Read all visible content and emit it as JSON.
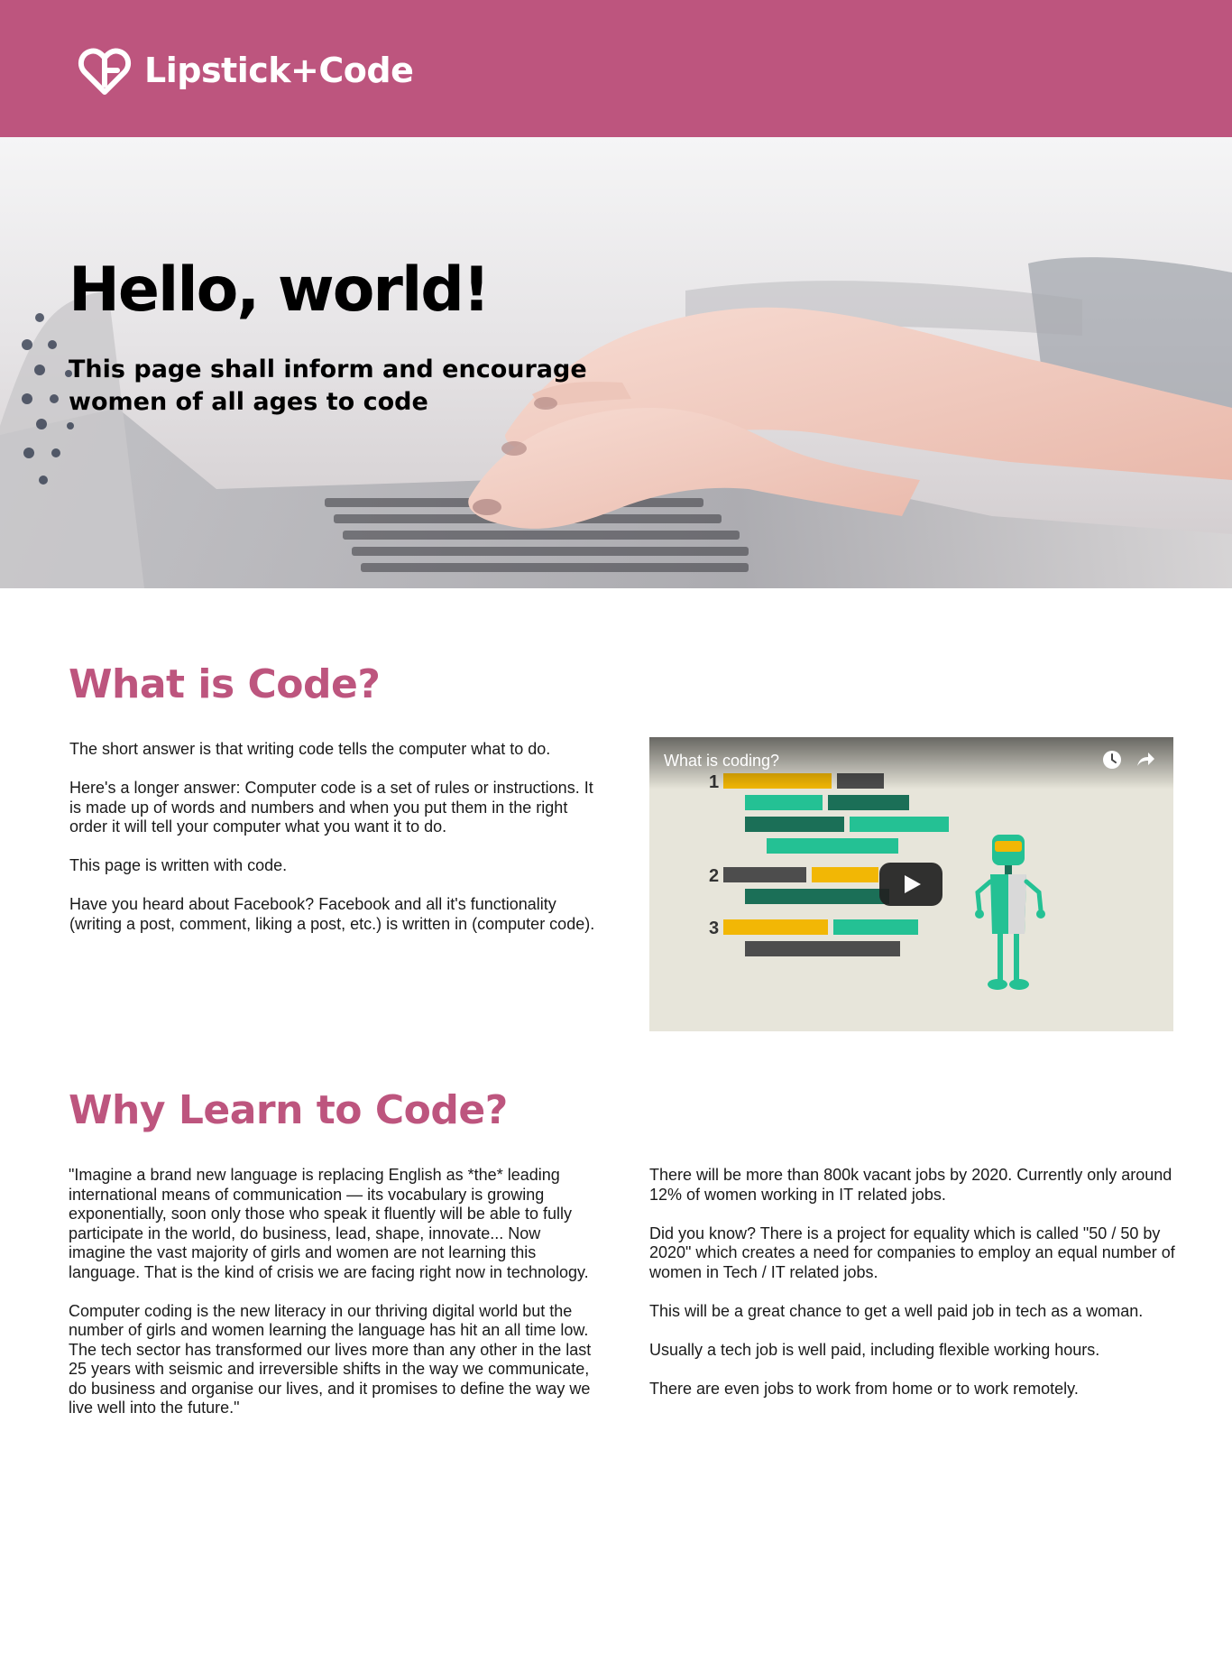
{
  "header": {
    "brand_name": "Lipstick+Code",
    "logo_icon": "heart-b-logo-icon"
  },
  "hero": {
    "title": "Hello, world!",
    "subtitle": "This page shall inform and encourage women of all ages to code"
  },
  "what": {
    "title": "What is Code?",
    "paragraphs": [
      "The short answer is that writing code tells the computer what to do.",
      "Here's a longer answer: Computer code is a set of rules or instructions. It is made up of words and numbers and when you put them in the right order it will tell your computer what you want it to do.",
      "This page is written with code.",
      "Have you heard about Facebook? Facebook and all it's functionality (writing a post, comment, liking a post, etc.) is written in (computer code)."
    ],
    "video": {
      "title": "What is coding?",
      "watch_later_icon": "clock-icon",
      "share_icon": "share-arrow-icon",
      "play_icon": "play-icon",
      "labels": [
        "1",
        "2",
        "3"
      ]
    }
  },
  "why": {
    "title": "Why Learn to Code?",
    "left_paragraphs": [
      "\"Imagine a brand new language is replacing English as *the* leading international means of communication — its vocabulary is growing exponentially, soon only those who speak it fluently will be able to fully participate in the world, do business, lead, shape, innovate... Now imagine the vast majority of girls and women are not learning this language. That is the kind of crisis we are facing right now in technology.",
      "Computer coding is the new literacy in our thriving digital world but the number of girls and women learning the language has hit an all time low. The tech sector has transformed our lives more than any other in the last 25 years with seismic and irreversible shifts in the way we communicate, do business and organise our lives, and it promises to define the way we live well into the future.\""
    ],
    "right_paragraphs": [
      "There will be more than 800k vacant jobs by 2020. Currently only around 12% of women working in IT related jobs.",
      "Did you know? There is a project for equality which is called \"50 / 50 by 2020\" which creates a need for companies to employ an equal number of women in Tech / IT related jobs.",
      "This will be a great chance to get a well paid job in tech as a woman.",
      "Usually a tech job is well paid, including flexible working hours.",
      "There are even jobs to work from home or to work remotely."
    ]
  },
  "colors": {
    "brand": "#bd557e",
    "text": "#1a1a1a",
    "video_yellow": "#f2b705",
    "video_green": "#24c194",
    "video_dark_green": "#1b6f57",
    "video_gray": "#4d4d4d"
  }
}
